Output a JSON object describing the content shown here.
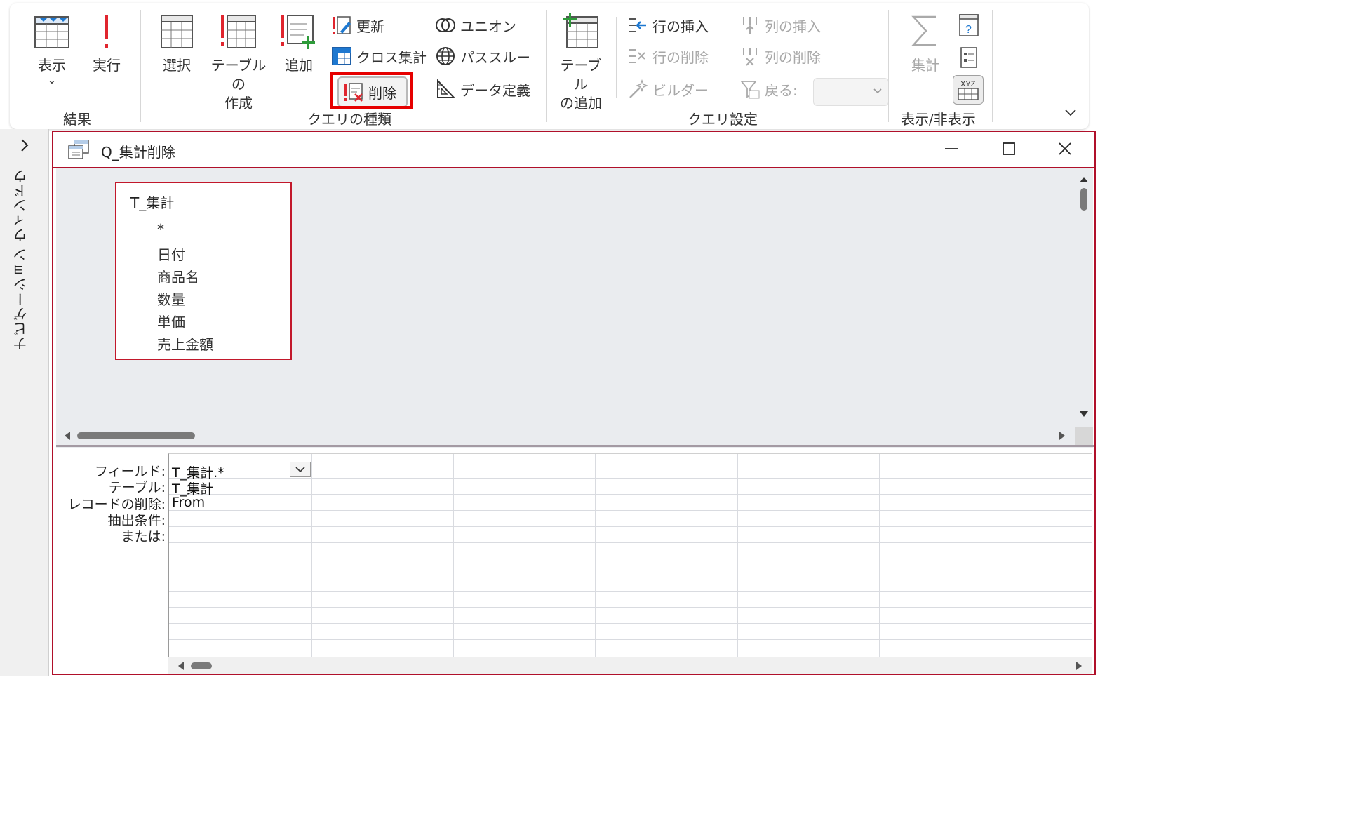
{
  "ribbon": {
    "groups": {
      "results": "結果",
      "query_type": "クエリの種類",
      "query_setup": "クエリ設定",
      "show_hide": "表示/非表示"
    },
    "results": {
      "view": "表示",
      "view_arrow": "⌄",
      "run": "実行"
    },
    "query_type": {
      "select": "選択",
      "make_table_1": "テーブルの",
      "make_table_2": "作成",
      "append": "追加",
      "update": "更新",
      "crosstab": "クロス集計",
      "delete": "削除",
      "union": "ユニオン",
      "pass_through": "パススルー",
      "data_definition": "データ定義"
    },
    "query_setup": {
      "add_table_1": "テーブル",
      "add_table_2": "の追加",
      "insert_rows": "行の挿入",
      "delete_rows": "行の削除",
      "builder": "ビルダー",
      "insert_columns": "列の挿入",
      "delete_columns": "列の削除",
      "return": "戻る:",
      "return_value": ""
    },
    "show_hide": {
      "totals": "集計"
    }
  },
  "nav_pane": {
    "label": "ナビゲーション ウィンドウ"
  },
  "query_window": {
    "title": "Q_集計削除",
    "table": {
      "name": "T_集計",
      "fields": [
        "*",
        "日付",
        "商品名",
        "数量",
        "単価",
        "売上金額"
      ]
    },
    "grid": {
      "row_labels": [
        "フィールド:",
        "テーブル:",
        "レコードの削除:",
        "抽出条件:",
        "または:"
      ],
      "column1": {
        "field": "T_集計.*",
        "table": "T_集計",
        "delete": "From"
      }
    }
  },
  "colors": {
    "highlight": "#e60000",
    "window_border": "#b0102a",
    "design_bg": "#eaecef"
  }
}
